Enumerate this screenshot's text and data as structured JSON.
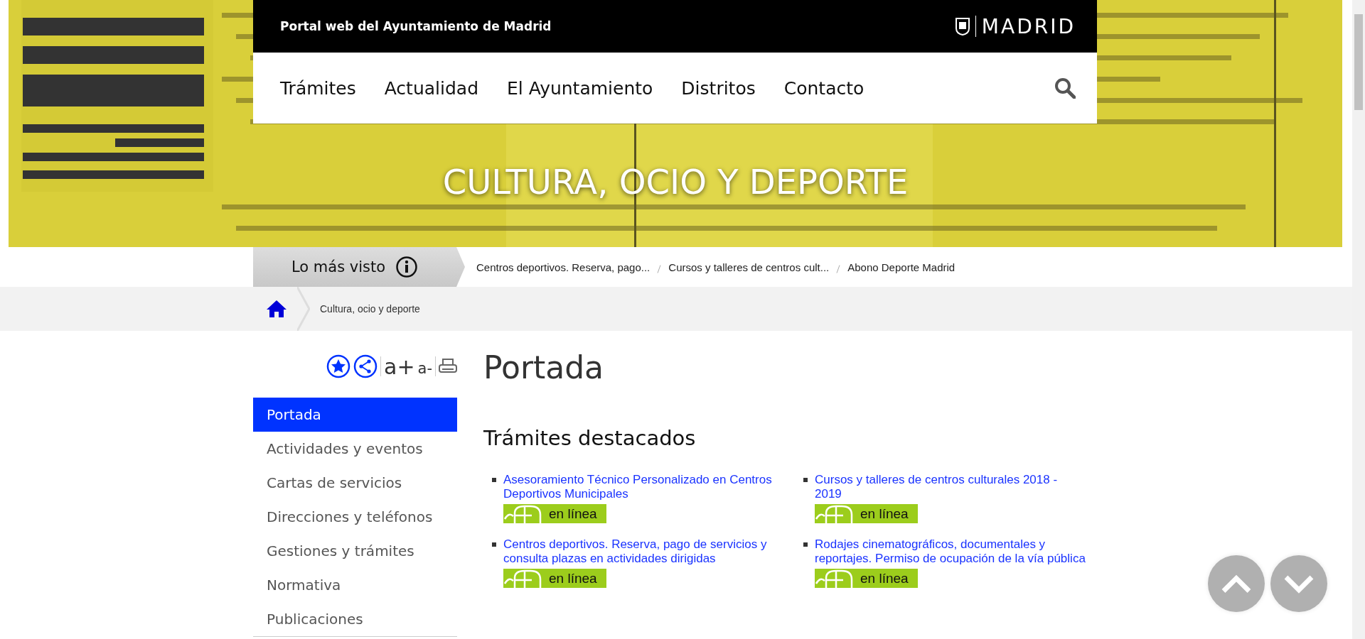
{
  "header": {
    "title": "Portal web del Ayuntamiento de Madrid",
    "brand": "MADRID"
  },
  "nav": {
    "items": [
      "Trámites",
      "Actualidad",
      "El Ayuntamiento",
      "Distritos",
      "Contacto"
    ]
  },
  "banner": {
    "kind": "picture",
    "title": "CULTURA, OCIO Y DEPORTE"
  },
  "most_viewed": {
    "label": "Lo más visto",
    "links": [
      "Centros deportivos. Reserva, pago...",
      "Cursos y talleres de centros cult...",
      "Abono Deporte Madrid"
    ]
  },
  "breadcrumb": {
    "items": [
      "Cultura, ocio y deporte"
    ]
  },
  "tools": {
    "font_increase": "a+",
    "font_decrease": "a-"
  },
  "sidebar": {
    "items": [
      {
        "label": "Portada",
        "selected": true
      },
      {
        "label": "Actividades y eventos",
        "selected": false
      },
      {
        "label": "Cartas de servicios",
        "selected": false
      },
      {
        "label": "Direcciones y teléfonos",
        "selected": false
      },
      {
        "label": "Gestiones y trámites",
        "selected": false
      },
      {
        "label": "Normativa",
        "selected": false
      },
      {
        "label": "Publicaciones",
        "selected": false
      }
    ]
  },
  "main": {
    "title": "Portada",
    "section": "Trámites destacados",
    "procedures": [
      {
        "title": "Asesoramiento Técnico Personalizado en Centros Deportivos Municipales",
        "badge": "en línea"
      },
      {
        "title": "Cursos y talleres de centros culturales 2018 - 2019",
        "badge": "en línea"
      },
      {
        "title": "Centros deportivos. Reserva, pago de servicios y consulta plazas en actividades dirigidas",
        "badge": "en línea"
      },
      {
        "title": "Rodajes cinematográficos, documentales y reportajes. Permiso de ocupación de la vía pública",
        "badge": "en línea"
      }
    ]
  }
}
